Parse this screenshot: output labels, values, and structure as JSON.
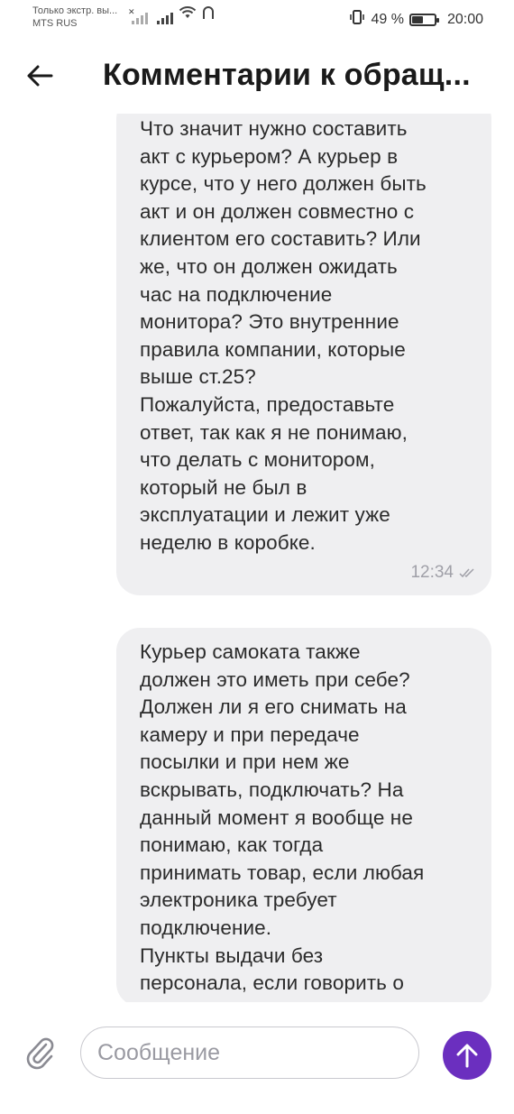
{
  "status_bar": {
    "carrier_top": "Только экстр. вы...",
    "carrier_name": "MTS RUS",
    "battery_percent_text": "49 %",
    "battery_level": 0.49,
    "time": "20:00",
    "icons": [
      "signal-off-icon",
      "signal-icon",
      "wifi-icon",
      "vpn-icon",
      "vibrate-icon",
      "battery-icon"
    ]
  },
  "header": {
    "title": "Комментарии к обращ...",
    "back_icon": "arrow-left-icon"
  },
  "messages": [
    {
      "text": "Что значит нужно составить\nакт с курьером? А курьер в\nкурсе, что у него должен быть\nакт и он должен совместно с\nклиентом его составить? Или\nже, что он должен ожидать\nчас на подключение\nмонитора? Это внутренние\nправила компании, которые\nвыше ст.25?\nПожалуйста, предоставьте\nответ, так как я не понимаю,\nчто делать с монитором,\nкоторый не был в\nэксплуатации и лежит уже\nнеделю в коробке.",
      "time": "12:34",
      "status_icon": "double-check-icon"
    },
    {
      "text": "Курьер самоката также\nдолжен это иметь при себе?\nДолжен ли я его снимать на\nкамеру и при передаче\nпосылки и при нем же\nвскрывать, подключать? На\nданный момент я вообще не\nпонимаю, как тогда\nпринимать товар, если любая\nэлектроника требует\nподключение.\nПункты выдачи без\nперсонала, если говорить о"
    }
  ],
  "composer": {
    "placeholder": "Сообщение",
    "value": "",
    "attach_icon": "paperclip-icon",
    "send_icon": "arrow-up-icon",
    "send_color": "#6b2fbf"
  }
}
